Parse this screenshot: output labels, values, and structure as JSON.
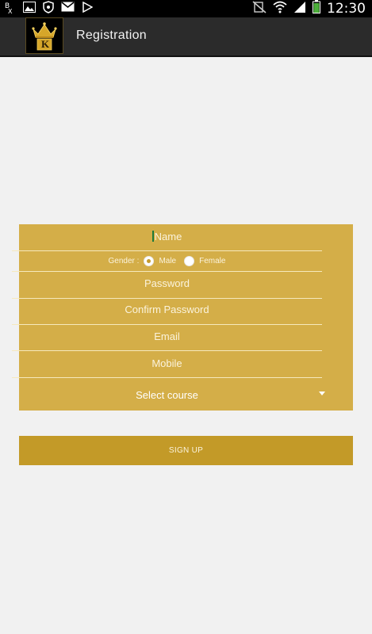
{
  "status_bar": {
    "time": "12:30",
    "left_icons": [
      "bx-notification-icon",
      "image-icon",
      "shield-icon",
      "gmail-icon",
      "play-store-icon"
    ],
    "right_icons": [
      "no-sim-icon",
      "wifi-icon",
      "signal-icon",
      "battery-icon"
    ]
  },
  "action_bar": {
    "title": "Registration",
    "logo_letter": "K"
  },
  "form": {
    "name_placeholder": "Name",
    "gender_label": "Gender :",
    "gender_options": [
      "Male",
      "Female"
    ],
    "gender_selected": "Male",
    "password_placeholder": "Password",
    "confirm_password_placeholder": "Confirm Password",
    "email_placeholder": "Email",
    "mobile_placeholder": "Mobile",
    "course_select": "Select course"
  },
  "signup_label": "SIGN UP",
  "colors": {
    "form_bg": "#d4ae48",
    "button_bg": "#c39a28",
    "page_bg": "#f1f1f1",
    "actionbar_bg": "#2b2b2b"
  }
}
